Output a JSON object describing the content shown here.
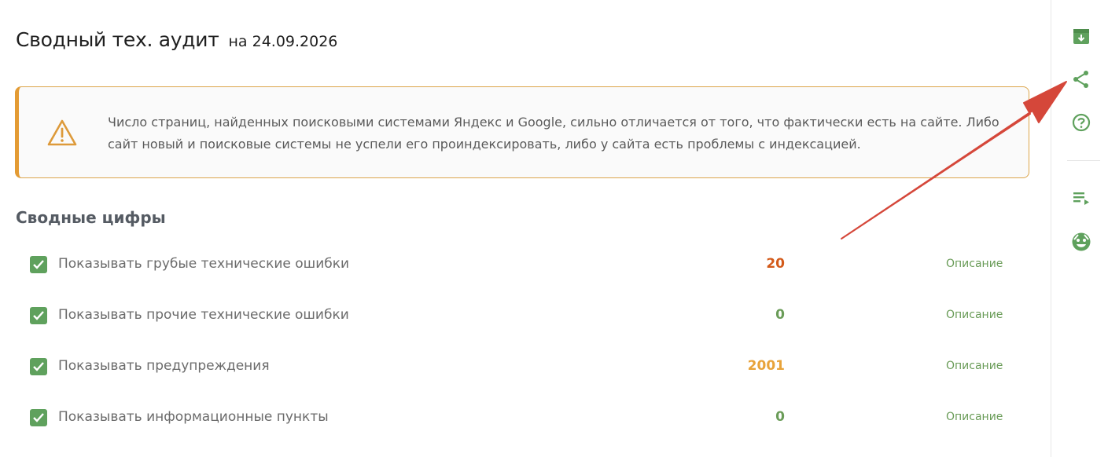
{
  "header": {
    "title": "Сводный тех. аудит",
    "date": "на 24.09.2026"
  },
  "warning": {
    "icon": "warning-triangle-icon",
    "line1": "Число страниц, найденных поисковыми системами Яндекс и Google, сильно отличается от того, что фактически есть на сайте. Либо",
    "line2": "сайт новый и поисковые системы не успели его проиндексировать, либо у сайта есть проблемы с индексацией."
  },
  "summary": {
    "title": "Сводные цифры",
    "rows": [
      {
        "label": "Показывать грубые технические ошибки",
        "count": "20",
        "count_color": "#d35a1a",
        "link": "Описание",
        "checked": true
      },
      {
        "label": "Показывать прочие технические ошибки",
        "count": "0",
        "count_color": "#6a9c58",
        "link": "Описание",
        "checked": true
      },
      {
        "label": "Показывать предупреждения",
        "count": "2001",
        "count_color": "#e8a33a",
        "link": "Описание",
        "checked": true
      },
      {
        "label": "Показывать информационные пункты",
        "count": "0",
        "count_color": "#6a9c58",
        "link": "Описание",
        "checked": true
      }
    ]
  },
  "sidebar": {
    "icons": [
      "download-archive-icon",
      "share-icon",
      "help-icon",
      "playlist-icon",
      "support-face-icon"
    ]
  },
  "colors": {
    "accent_green": "#5fa15d",
    "warning_border": "#e39b34",
    "annotation_arrow": "#d5473a"
  }
}
